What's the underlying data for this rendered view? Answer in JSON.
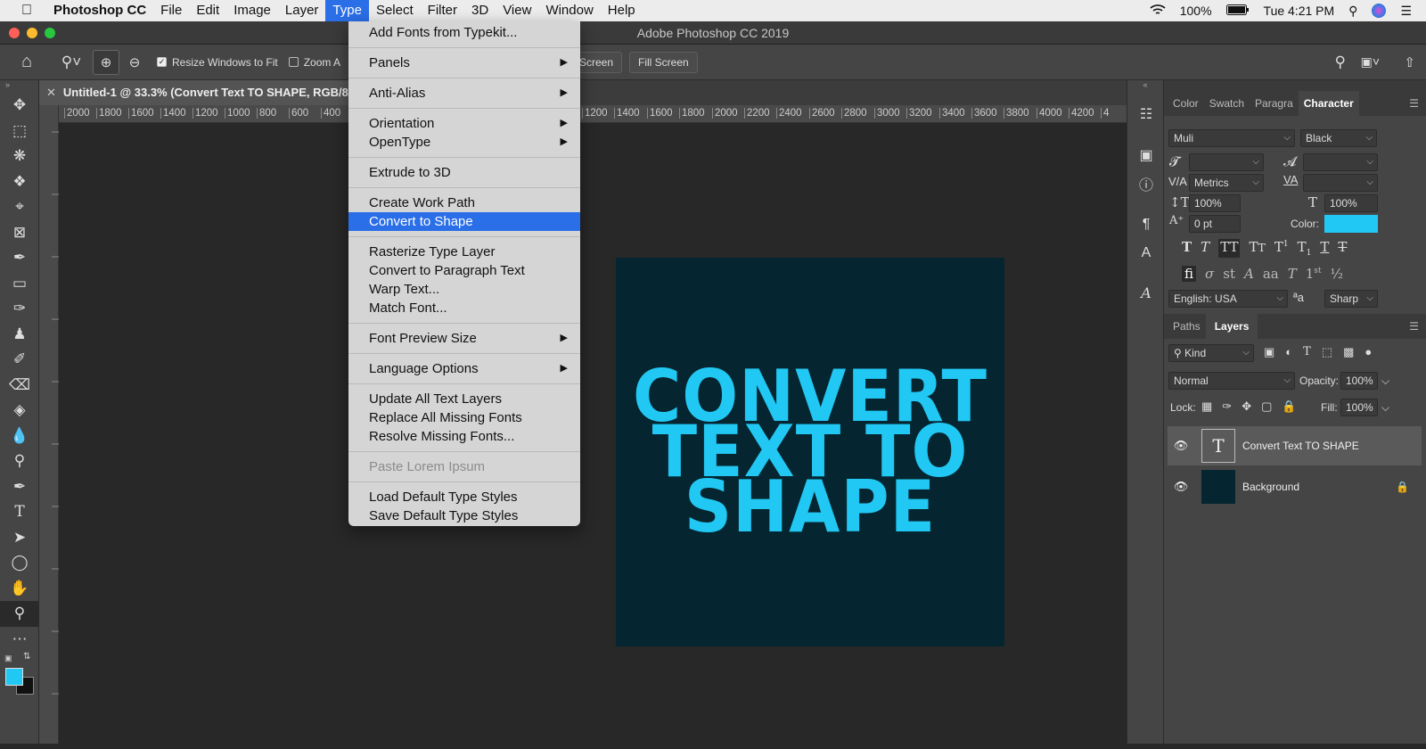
{
  "menubar": {
    "app": "Photoshop CC",
    "items": [
      "File",
      "Edit",
      "Image",
      "Layer",
      "Type",
      "Select",
      "Filter",
      "3D",
      "View",
      "Window",
      "Help"
    ],
    "active": "Type",
    "battery": "100%",
    "clock": "Tue 4:21 PM"
  },
  "window": {
    "title": "Adobe Photoshop CC 2019"
  },
  "options": {
    "resize_windows": "Resize Windows to Fit",
    "zoom_all": "Zoom A",
    "screen_btn": "Screen",
    "fill_screen": "Fill Screen"
  },
  "document": {
    "tab_title": "Untitled-1 @ 33.3% (Convert Text TO SHAPE, RGB/8",
    "ruler_labels": [
      "2000",
      "1800",
      "1600",
      "1400",
      "1200",
      "1000",
      "800",
      "600",
      "400",
      "1200",
      "1400",
      "1600",
      "1800",
      "2000",
      "2200",
      "2400",
      "2600",
      "2800",
      "3000",
      "3200",
      "3400",
      "3600",
      "3800",
      "4000",
      "4200",
      "4"
    ],
    "artboard_lines": [
      "CONVERT",
      "TEXT TO",
      "SHAPE"
    ]
  },
  "type_menu": {
    "add_fonts": "Add Fonts from Typekit...",
    "panels": "Panels",
    "anti_alias": "Anti-Alias",
    "orientation": "Orientation",
    "opentype": "OpenType",
    "extrude": "Extrude to 3D",
    "create_work_path": "Create Work Path",
    "convert_to_shape": "Convert to Shape",
    "rasterize": "Rasterize Type Layer",
    "convert_paragraph": "Convert to Paragraph Text",
    "warp": "Warp Text...",
    "match_font": "Match Font...",
    "font_preview": "Font Preview Size",
    "language": "Language Options",
    "update_all": "Update All Text Layers",
    "replace_missing": "Replace All Missing Fonts",
    "resolve_missing": "Resolve Missing Fonts...",
    "paste_lorem": "Paste Lorem Ipsum",
    "load_default": "Load Default Type Styles",
    "save_default": "Save Default Type Styles"
  },
  "character_panel": {
    "tabs": [
      "Color",
      "Swatch",
      "Paragra",
      "Character"
    ],
    "font_family": "Muli",
    "font_style": "Black",
    "kerning": "Metrics",
    "vscale": "100%",
    "hscale": "100%",
    "baseline": "0 pt",
    "color_label": "Color:",
    "color_value": "#21c8f4",
    "language": "English: USA",
    "aa_label": "ªa",
    "antialias": "Sharp"
  },
  "layers_panel": {
    "tabs": [
      "Paths",
      "Layers"
    ],
    "filter_kind": "Kind",
    "blend_mode": "Normal",
    "opacity_label": "Opacity:",
    "opacity": "100%",
    "lock_label": "Lock:",
    "fill_label": "Fill:",
    "fill": "100%",
    "layers": [
      {
        "name": "Convert Text TO SHAPE",
        "type": "text"
      },
      {
        "name": "Background",
        "type": "background"
      }
    ]
  }
}
